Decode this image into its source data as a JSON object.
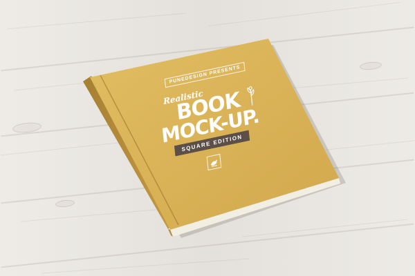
{
  "cover": {
    "presents": "PUNEDESIGN PRESENTS",
    "subtitle_script": "Realistic",
    "title_line1": "BOOK",
    "title_line2": "MOCK-UP.",
    "edition": "SQUARE EDITION"
  },
  "colors": {
    "cover": "#dcb356",
    "cover_edge": "#b88f3a",
    "pages": "#f4efe2",
    "band": "#5b4f47",
    "wood": "#ebe8e3"
  },
  "icons": {
    "sprig": "plant-sprig-icon",
    "logo": "bird-logo-icon"
  }
}
